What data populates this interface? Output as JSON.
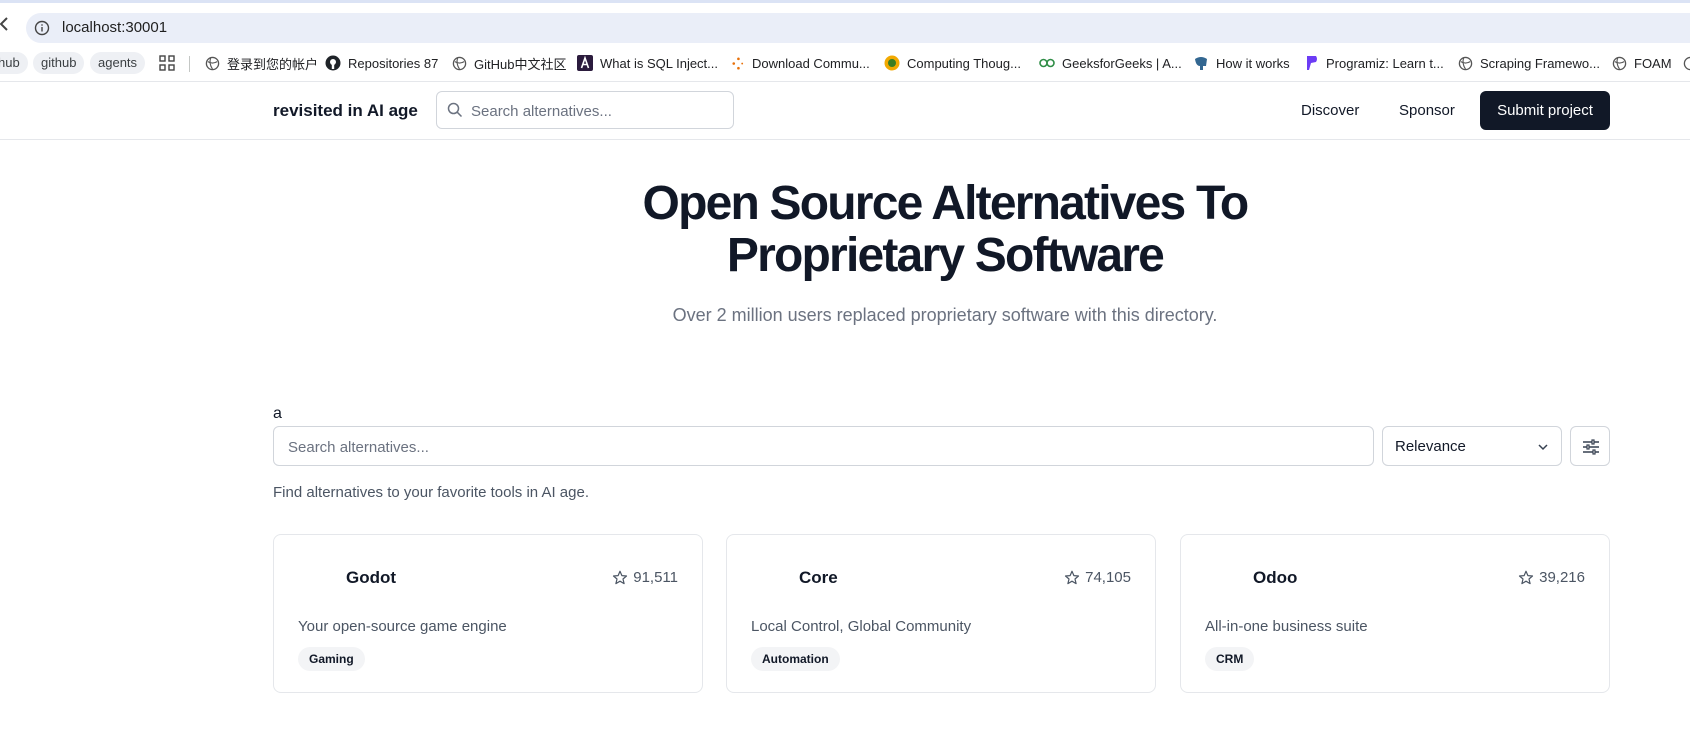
{
  "browser": {
    "url": "localhost:30001",
    "bookmarks": {
      "chips": [
        "hub",
        "github",
        "agents"
      ],
      "items": [
        "登录到您的帐户",
        "Repositories 87",
        "GitHub中文社区",
        "What is SQL Inject...",
        "Download Commu...",
        "Computing Thoug...",
        "GeeksforGeeks | A...",
        "How it works",
        "Programiz: Learn t...",
        "Scraping Framewo...",
        "FOAM"
      ]
    }
  },
  "nav": {
    "brand": "revisited in AI age",
    "search_placeholder": "Search alternatives...",
    "discover": "Discover",
    "sponsor": "Sponsor",
    "submit": "Submit project"
  },
  "hero": {
    "title_line1": "Open Source Alternatives To",
    "title_line2": "Proprietary Software",
    "subtitle": "Over 2 million users replaced proprietary software with this directory."
  },
  "listing": {
    "stray_text": "a",
    "search_placeholder": "Search alternatives...",
    "sort_value": "Relevance",
    "hint": "Find alternatives to your favorite tools in AI age."
  },
  "cards": [
    {
      "name": "Godot",
      "stars": "91,511",
      "description": "Your open-source game engine",
      "tag": "Gaming"
    },
    {
      "name": "Core",
      "stars": "74,105",
      "description": "Local Control, Global Community",
      "tag": "Automation"
    },
    {
      "name": "Odoo",
      "stars": "39,216",
      "description": "All-in-one business suite",
      "tag": "CRM"
    }
  ]
}
